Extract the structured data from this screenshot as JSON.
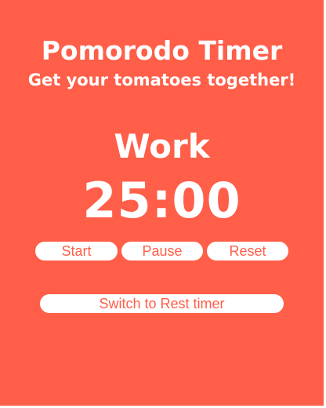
{
  "header": {
    "title": "Pomorodo Timer",
    "subtitle": "Get your tomatoes together!"
  },
  "timer": {
    "mode": "Work",
    "time": "25:00"
  },
  "controls": {
    "start_label": "Start",
    "pause_label": "Pause",
    "reset_label": "Reset",
    "switch_label": "Switch to Rest timer"
  },
  "colors": {
    "background": "#ff5e49",
    "text": "#ffffff",
    "button_background": "#ffffff",
    "button_text": "#ff5e49"
  }
}
